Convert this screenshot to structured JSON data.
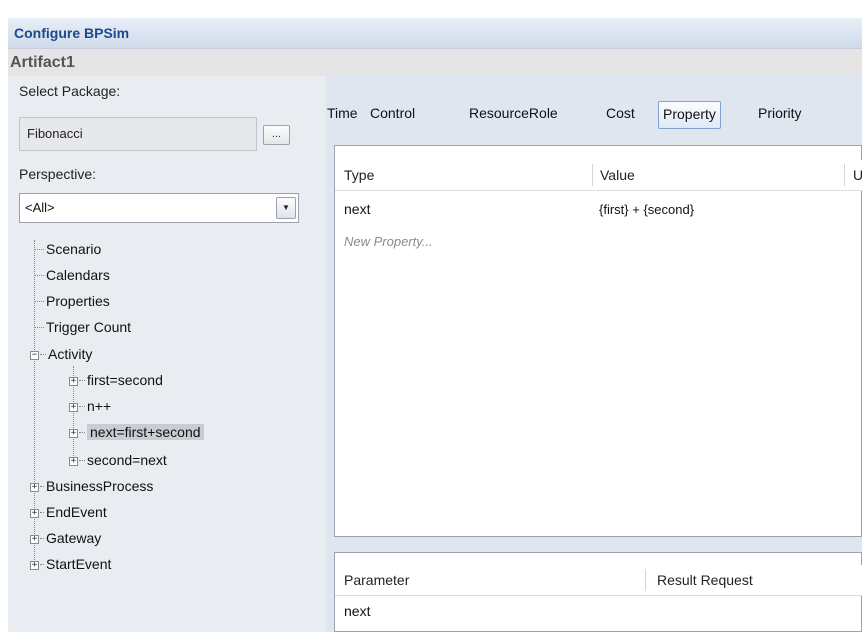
{
  "window": {
    "title": "Configure BPSim",
    "subtitle": "Artifact1"
  },
  "left": {
    "select_package_label": "Select Package:",
    "package_value": "Fibonacci",
    "browse_button_label": "...",
    "perspective_label": "Perspective:",
    "perspective_value": "<All>",
    "tree": [
      {
        "label": "Scenario"
      },
      {
        "label": "Calendars"
      },
      {
        "label": "Properties"
      },
      {
        "label": "Trigger Count"
      },
      {
        "label": "Activity",
        "expander": "−"
      },
      {
        "label": "first=second",
        "expander": "+"
      },
      {
        "label": "n++",
        "expander": "+"
      },
      {
        "label": "next=first+second",
        "expander": "+",
        "selected": true
      },
      {
        "label": "second=next",
        "expander": "+"
      },
      {
        "label": "BusinessProcess",
        "expander": "+"
      },
      {
        "label": "EndEvent",
        "expander": "+"
      },
      {
        "label": "Gateway",
        "expander": "+"
      },
      {
        "label": "StartEvent",
        "expander": "+"
      }
    ]
  },
  "tabs": [
    {
      "label": "Time"
    },
    {
      "label": "Control"
    },
    {
      "label": "ResourceRole"
    },
    {
      "label": "Cost"
    },
    {
      "label": "Property",
      "active": true
    },
    {
      "label": "Priority"
    }
  ],
  "property_grid": {
    "columns": [
      "Type",
      "Value",
      "U"
    ],
    "rows": [
      {
        "type": "next",
        "value": "{first} + {second}"
      }
    ],
    "new_row_placeholder": "New Property..."
  },
  "parameter_grid": {
    "columns": [
      "Parameter",
      "Result Request"
    ],
    "rows": [
      {
        "parameter": "next"
      }
    ]
  },
  "colors": {
    "title_text": "#1c4a8a",
    "window_bg": "#dfe6f0",
    "selection_bg": "#c9cdd3"
  }
}
